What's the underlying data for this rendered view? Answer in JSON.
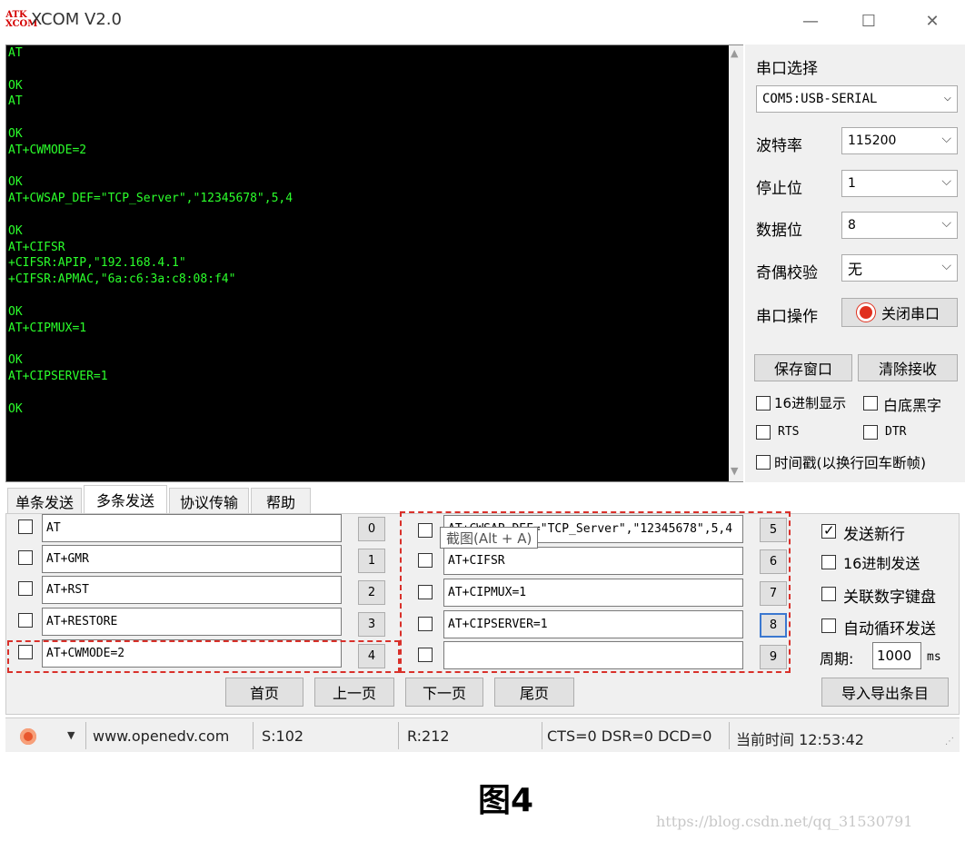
{
  "window": {
    "logo_text": "ATK XCOM",
    "title": "XCOM V2.0",
    "min_glyph": "—",
    "max_glyph": "☐",
    "close_glyph": "✕"
  },
  "receive": {
    "text": "AT\n\nOK\nAT\n\nOK\nAT+CWMODE=2\n\nOK\nAT+CWSAP_DEF=\"TCP_Server\",\"12345678\",5,4\n\nOK\nAT+CIFSR\n+CIFSR:APIP,\"192.168.4.1\"\n+CIFSR:APMAC,\"6a:c6:3a:c8:08:f4\"\n\nOK\nAT+CIPMUX=1\n\nOK\nAT+CIPSERVER=1\n\nOK"
  },
  "settings": {
    "port_label": "串口选择",
    "port_value": "COM5:USB-SERIAL",
    "baud_label": "波特率",
    "baud_value": "115200",
    "stop_label": "停止位",
    "stop_value": "1",
    "data_label": "数据位",
    "data_value": "8",
    "parity_label": "奇偶校验",
    "parity_value": "无",
    "op_label": "串口操作",
    "op_button": "关闭串口",
    "save_button": "保存窗口",
    "clear_button": "清除接收",
    "hex_display": "16进制显示",
    "white_black": "白底黑字",
    "rts": "RTS",
    "dtr": "DTR",
    "timestamp": "时间戳(以换行回车断帧)"
  },
  "tabs": [
    "单条发送",
    "多条发送",
    "协议传输",
    "帮助"
  ],
  "multi_send": {
    "left": [
      {
        "text": "AT",
        "num": "0"
      },
      {
        "text": "AT+GMR",
        "num": "1"
      },
      {
        "text": "AT+RST",
        "num": "2"
      },
      {
        "text": "AT+RESTORE",
        "num": "3"
      },
      {
        "text": "AT+CWMODE=2",
        "num": "4"
      }
    ],
    "right": [
      {
        "text": "AT+CWSAP_DEF=\"TCP_Server\",\"12345678\",5,4",
        "num": "5"
      },
      {
        "text": "AT+CIFSR",
        "num": "6"
      },
      {
        "text": "AT+CIPMUX=1",
        "num": "7"
      },
      {
        "text": "AT+CIPSERVER=1",
        "num": "8"
      },
      {
        "text": "",
        "num": "9"
      }
    ],
    "tooltip": "截图(Alt + A)",
    "send_newline": "发送新行",
    "hex_send": "16进制发送",
    "link_keypad": "关联数字键盘",
    "auto_loop": "自动循环发送",
    "period_label": "周期:",
    "period_value": "1000",
    "period_unit": "ms",
    "first_page": "首页",
    "prev_page": "上一页",
    "next_page": "下一页",
    "last_page": "尾页",
    "import_export": "导入导出条目"
  },
  "status": {
    "url": "www.openedv.com",
    "sent": "S:102",
    "received": "R:212",
    "signals": "CTS=0 DSR=0 DCD=0",
    "time": "当前时间 12:53:42"
  },
  "caption": "图4",
  "watermark": "https://blog.csdn.net/qq_31530791"
}
